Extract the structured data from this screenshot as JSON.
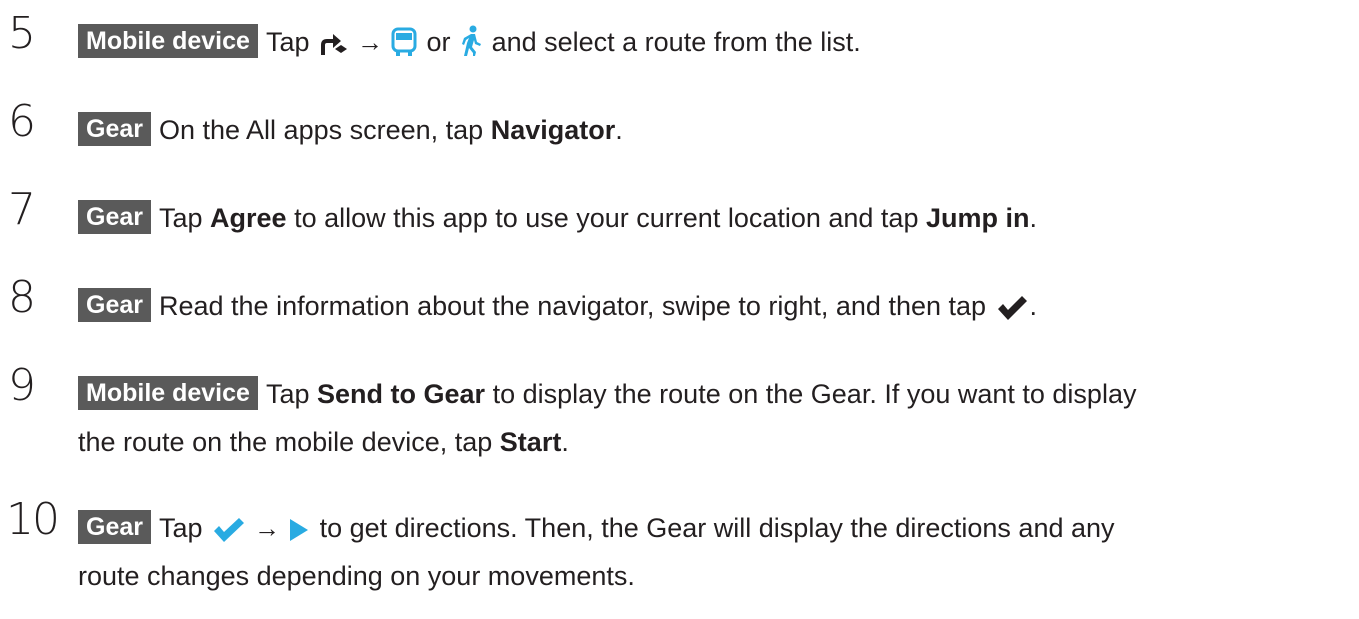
{
  "steps": [
    {
      "number": "5",
      "tag": "Mobile device",
      "t1": "Tap",
      "arrow": "→",
      "t2": "or",
      "t3": "and select a route from the list."
    },
    {
      "number": "6",
      "tag": "Gear",
      "t1": "On the All apps screen, tap",
      "b1": "Navigator",
      "t2": "."
    },
    {
      "number": "7",
      "tag": "Gear",
      "t1": "Tap",
      "b1": "Agree",
      "t2": "to allow this app to use your current location and tap",
      "b2": "Jump in",
      "t3": "."
    },
    {
      "number": "8",
      "tag": "Gear",
      "t1": "Read the information about the navigator, swipe to right, and then tap",
      "t2": "."
    },
    {
      "number": "9",
      "tag": "Mobile device",
      "t1": "Tap",
      "b1": "Send to Gear",
      "t2": "to display the route on the Gear. If you want to display",
      "l2_t1": "the route on the mobile device, tap",
      "l2_b1": "Start",
      "l2_t2": "."
    },
    {
      "number": "10",
      "tag": "Gear",
      "t1": "Tap",
      "arrow": "→",
      "t2": "to get directions. Then, the Gear will display the directions and any",
      "l2_t1": "route changes depending on your movements."
    }
  ],
  "icons": {
    "directions": "directions-icon",
    "transit": "bus-icon",
    "walk": "walking-icon",
    "check_dark": "checkmark-icon",
    "check_blue": "checkmark-blue-icon",
    "play": "play-icon"
  },
  "colors": {
    "tag_bg": "#5a5a5a",
    "icon_blue": "#29abe2",
    "text": "#231f20"
  }
}
